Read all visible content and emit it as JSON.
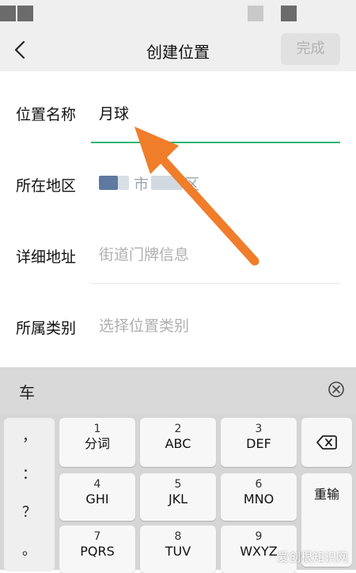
{
  "header": {
    "title": "创建位置",
    "done_label": "完成",
    "back_icon": "chevron-left-icon"
  },
  "form": {
    "name": {
      "label": "位置名称",
      "value": "月球"
    },
    "region": {
      "label": "所在地区",
      "city_suffix": "市",
      "district_suffix": "区"
    },
    "address": {
      "label": "详细地址",
      "placeholder": "街道门牌信息"
    },
    "category": {
      "label": "所属类别",
      "placeholder": "选择位置类别"
    }
  },
  "keyboard": {
    "candidate": "车",
    "candidate_close_icon": "circle-x-icon",
    "punctuation": [
      "，",
      "：",
      "？",
      "。"
    ],
    "keys": [
      {
        "num": "1",
        "letters": "分词"
      },
      {
        "num": "2",
        "letters": "ABC"
      },
      {
        "num": "3",
        "letters": "DEF"
      },
      {
        "num": "4",
        "letters": "GHI"
      },
      {
        "num": "5",
        "letters": "JKL"
      },
      {
        "num": "6",
        "letters": "MNO"
      },
      {
        "num": "7",
        "letters": "PQRS"
      },
      {
        "num": "8",
        "letters": "TUV"
      },
      {
        "num": "9",
        "letters": "WXYZ"
      }
    ],
    "backspace_icon": "backspace-icon",
    "reenter_label": "重输"
  },
  "watermark": "爱创根知识网",
  "colors": {
    "accent_underline": "#2bb673",
    "arrow": "#f07d2a",
    "header_bg": "#efefef",
    "keyboard_bg": "#d6d6d6"
  }
}
